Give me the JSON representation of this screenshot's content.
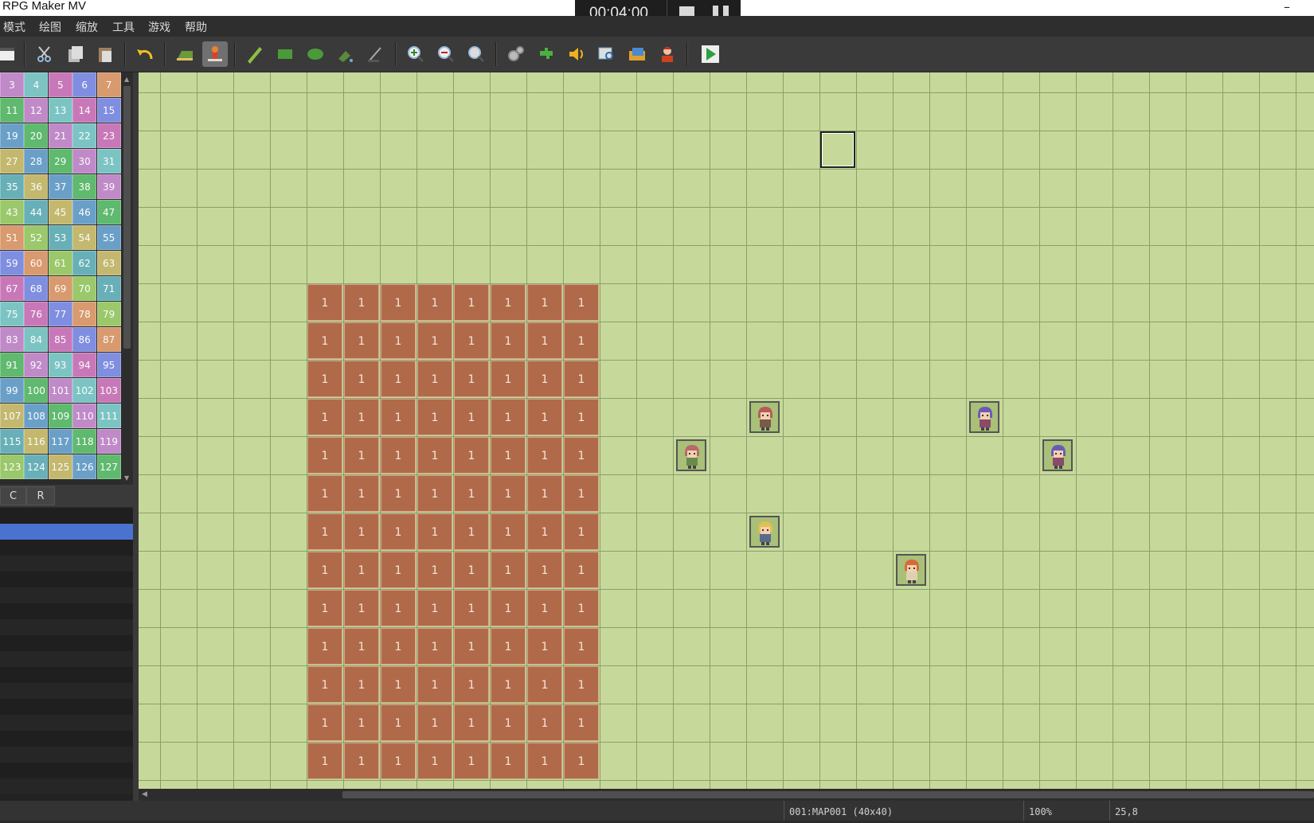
{
  "window": {
    "title": "RPG Maker MV",
    "minimize": "–"
  },
  "recorder": {
    "time": "00:04:00"
  },
  "menu": [
    "模式",
    "绘图",
    "缩放",
    "工具",
    "游戏",
    "帮助"
  ],
  "toolbar": {
    "groups": [
      [
        "save"
      ],
      [
        "cut",
        "copy",
        "paste"
      ],
      [
        "undo"
      ],
      [
        "map-mode",
        "event-mode"
      ],
      [
        "pencil",
        "rectangle",
        "ellipse",
        "flood-fill",
        "shadow-pen"
      ],
      [
        "zoom-in",
        "zoom-out",
        "actual-size"
      ],
      [
        "database",
        "plugin-manager",
        "sound-test",
        "event-searcher",
        "resource-manager",
        "character-generator"
      ],
      [
        "playtest"
      ]
    ],
    "active": "event-mode"
  },
  "palette": {
    "rows": [
      [
        "3",
        "4",
        "5",
        "6",
        "7"
      ],
      [
        "11",
        "12",
        "13",
        "14",
        "15"
      ],
      [
        "19",
        "20",
        "21",
        "22",
        "23"
      ],
      [
        "27",
        "28",
        "29",
        "30",
        "31"
      ],
      [
        "35",
        "36",
        "37",
        "38",
        "39"
      ],
      [
        "43",
        "44",
        "45",
        "46",
        "47"
      ],
      [
        "51",
        "52",
        "53",
        "54",
        "55"
      ],
      [
        "59",
        "60",
        "61",
        "62",
        "63"
      ],
      [
        "67",
        "68",
        "69",
        "70",
        "71"
      ],
      [
        "75",
        "76",
        "77",
        "78",
        "79"
      ],
      [
        "83",
        "84",
        "85",
        "86",
        "87"
      ],
      [
        "91",
        "92",
        "93",
        "94",
        "95"
      ],
      [
        "99",
        "100",
        "101",
        "102",
        "103"
      ],
      [
        "107",
        "108",
        "109",
        "110",
        "111"
      ],
      [
        "115",
        "116",
        "117",
        "118",
        "119"
      ],
      [
        "123",
        "124",
        "125",
        "126",
        "127"
      ]
    ],
    "colors": [
      "#c3b86e",
      "#6aa0c8",
      "#5fb96e",
      "#c08ac8",
      "#7cc4c4",
      "#c878b8",
      "#7f8ee0",
      "#d89a6e",
      "#9ac86a",
      "#68b0b8"
    ]
  },
  "tabs": {
    "c": "C",
    "r": "R"
  },
  "map": {
    "region_value": "1",
    "region_columns": 8,
    "region_rows": 13,
    "region_start_col": 5,
    "region_start_row": 5,
    "cursor": {
      "col": 19,
      "row": 1
    },
    "events": [
      {
        "col": 17,
        "row": 8,
        "hair": "#b85a5a",
        "cloth": "#7a5a4a"
      },
      {
        "col": 23,
        "row": 8,
        "hair": "#6a5ab8",
        "cloth": "#8a4a6a"
      },
      {
        "col": 15,
        "row": 9,
        "hair": "#b86a6a",
        "cloth": "#6a8a4a"
      },
      {
        "col": 25,
        "row": 9,
        "hair": "#6a5ab8",
        "cloth": "#8a4a6a"
      },
      {
        "col": 17,
        "row": 11,
        "hair": "#e0c050",
        "cloth": "#5a6a8a"
      },
      {
        "col": 21,
        "row": 12,
        "hair": "#d86a3a",
        "cloth": "#e0d0b0"
      }
    ]
  },
  "status": {
    "map": "001:MAP001 (40x40)",
    "zoom": "100%",
    "coords": "25,8"
  }
}
